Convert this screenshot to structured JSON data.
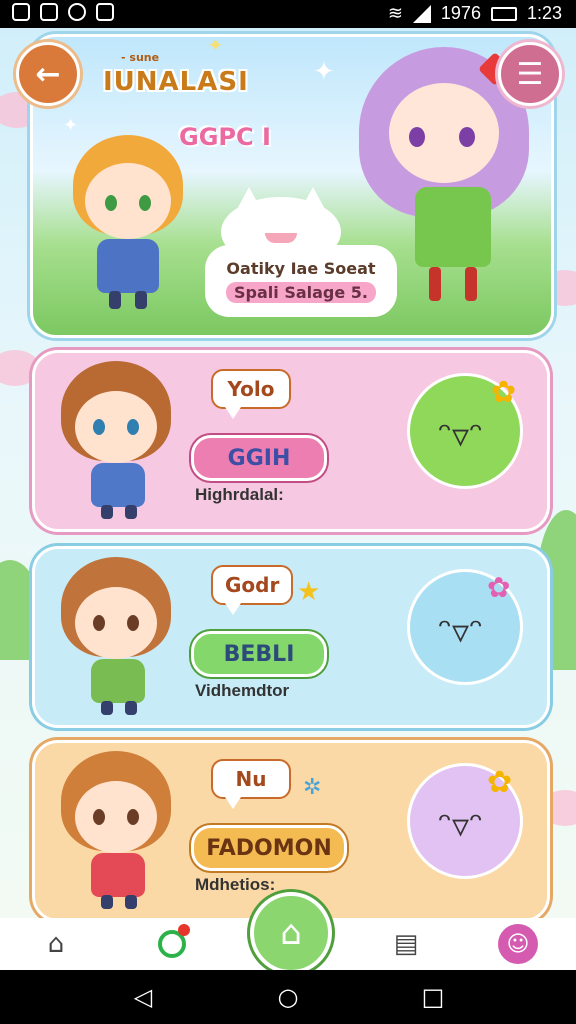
{
  "status_bar": {
    "time": "1:23",
    "battery": "1976"
  },
  "hero": {
    "title": "IUNALASI",
    "small_tag": "- sune",
    "subtitle": "GGPC I",
    "bubble_line1": "Oatiky Iae Soeat",
    "bubble_line2": "Spali Salage 5."
  },
  "cards": [
    {
      "speech": "Yolo",
      "button": "GGIH",
      "label": "Highrdalal:"
    },
    {
      "speech": "Godr",
      "button": "BEBLI",
      "label": "Vidhemdtor"
    },
    {
      "speech": "Nu",
      "button": "FADOMON",
      "label": "Mdhetios:"
    }
  ],
  "bottom_nav": {
    "home_label": "⌂",
    "items": [
      "home-outline-icon",
      "timer-icon",
      "home-active-icon",
      "document-icon",
      "profile-icon"
    ]
  },
  "colors": {
    "pink_card": "#f7c8e2",
    "blue_card": "#c8ecf7",
    "orange_card": "#fbd9a6",
    "green_accent": "#8bd66e"
  }
}
